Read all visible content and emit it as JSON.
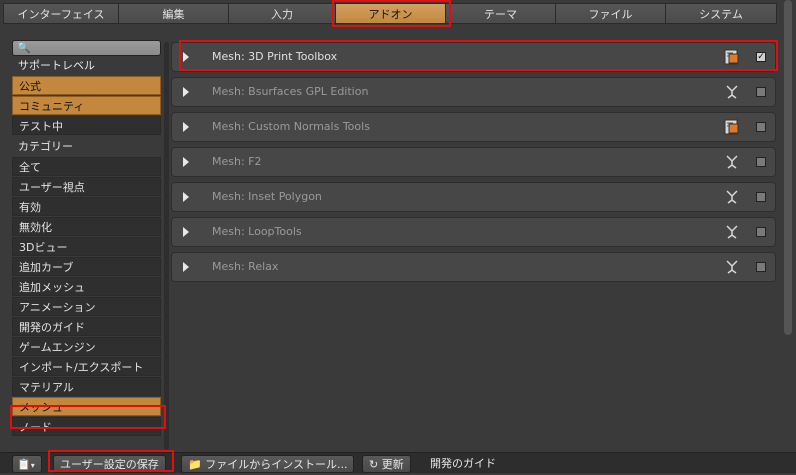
{
  "tabs": [
    {
      "label": "インターフェイス",
      "active": false
    },
    {
      "label": "編集",
      "active": false
    },
    {
      "label": "入力",
      "active": false
    },
    {
      "label": "アドオン",
      "active": true
    },
    {
      "label": "テーマ",
      "active": false
    },
    {
      "label": "ファイル",
      "active": false
    },
    {
      "label": "システム",
      "active": false
    }
  ],
  "sidebar": {
    "search_icon": "magnifier-icon",
    "support_level_label": "サポートレベル",
    "support_levels": [
      {
        "label": "公式",
        "selected": true
      },
      {
        "label": "コミュニティ",
        "selected": true
      },
      {
        "label": "テスト中",
        "selected": false
      }
    ],
    "category_label": "カテゴリー",
    "categories": [
      {
        "label": "全て",
        "selected": false
      },
      {
        "label": "ユーザー視点",
        "selected": false
      },
      {
        "label": "有効",
        "selected": false
      },
      {
        "label": "無効化",
        "selected": false
      },
      {
        "label": "3Dビュー",
        "selected": false
      },
      {
        "label": "追加カーブ",
        "selected": false
      },
      {
        "label": "追加メッシュ",
        "selected": false
      },
      {
        "label": "アニメーション",
        "selected": false
      },
      {
        "label": "開発のガイド",
        "selected": false
      },
      {
        "label": "ゲームエンジン",
        "selected": false
      },
      {
        "label": "インポート/エクスポート",
        "selected": false
      },
      {
        "label": "マテリアル",
        "selected": false
      },
      {
        "label": "メッシュ",
        "selected": true
      },
      {
        "label": "ノード",
        "selected": false
      }
    ]
  },
  "addons": [
    {
      "name": "Mesh: 3D Print Toolbox",
      "enabled": true,
      "icon": "official-addon-icon"
    },
    {
      "name": "Mesh: Bsurfaces GPL Edition",
      "enabled": false,
      "icon": "community-addon-icon"
    },
    {
      "name": "Mesh: Custom Normals Tools",
      "enabled": false,
      "icon": "official-addon-icon"
    },
    {
      "name": "Mesh: F2",
      "enabled": false,
      "icon": "community-addon-icon"
    },
    {
      "name": "Mesh: Inset Polygon",
      "enabled": false,
      "icon": "community-addon-icon"
    },
    {
      "name": "Mesh: LoopTools",
      "enabled": false,
      "icon": "community-addon-icon"
    },
    {
      "name": "Mesh: Relax",
      "enabled": false,
      "icon": "community-addon-icon"
    }
  ],
  "bottombar": {
    "save_label": "ユーザー設定の保存",
    "install_label": "ファイルからインストール...",
    "refresh_label": "更新",
    "dev_guide_label": "開発のガイド"
  },
  "colors": {
    "accent": "#c3873e",
    "highlight": "#e01010"
  }
}
